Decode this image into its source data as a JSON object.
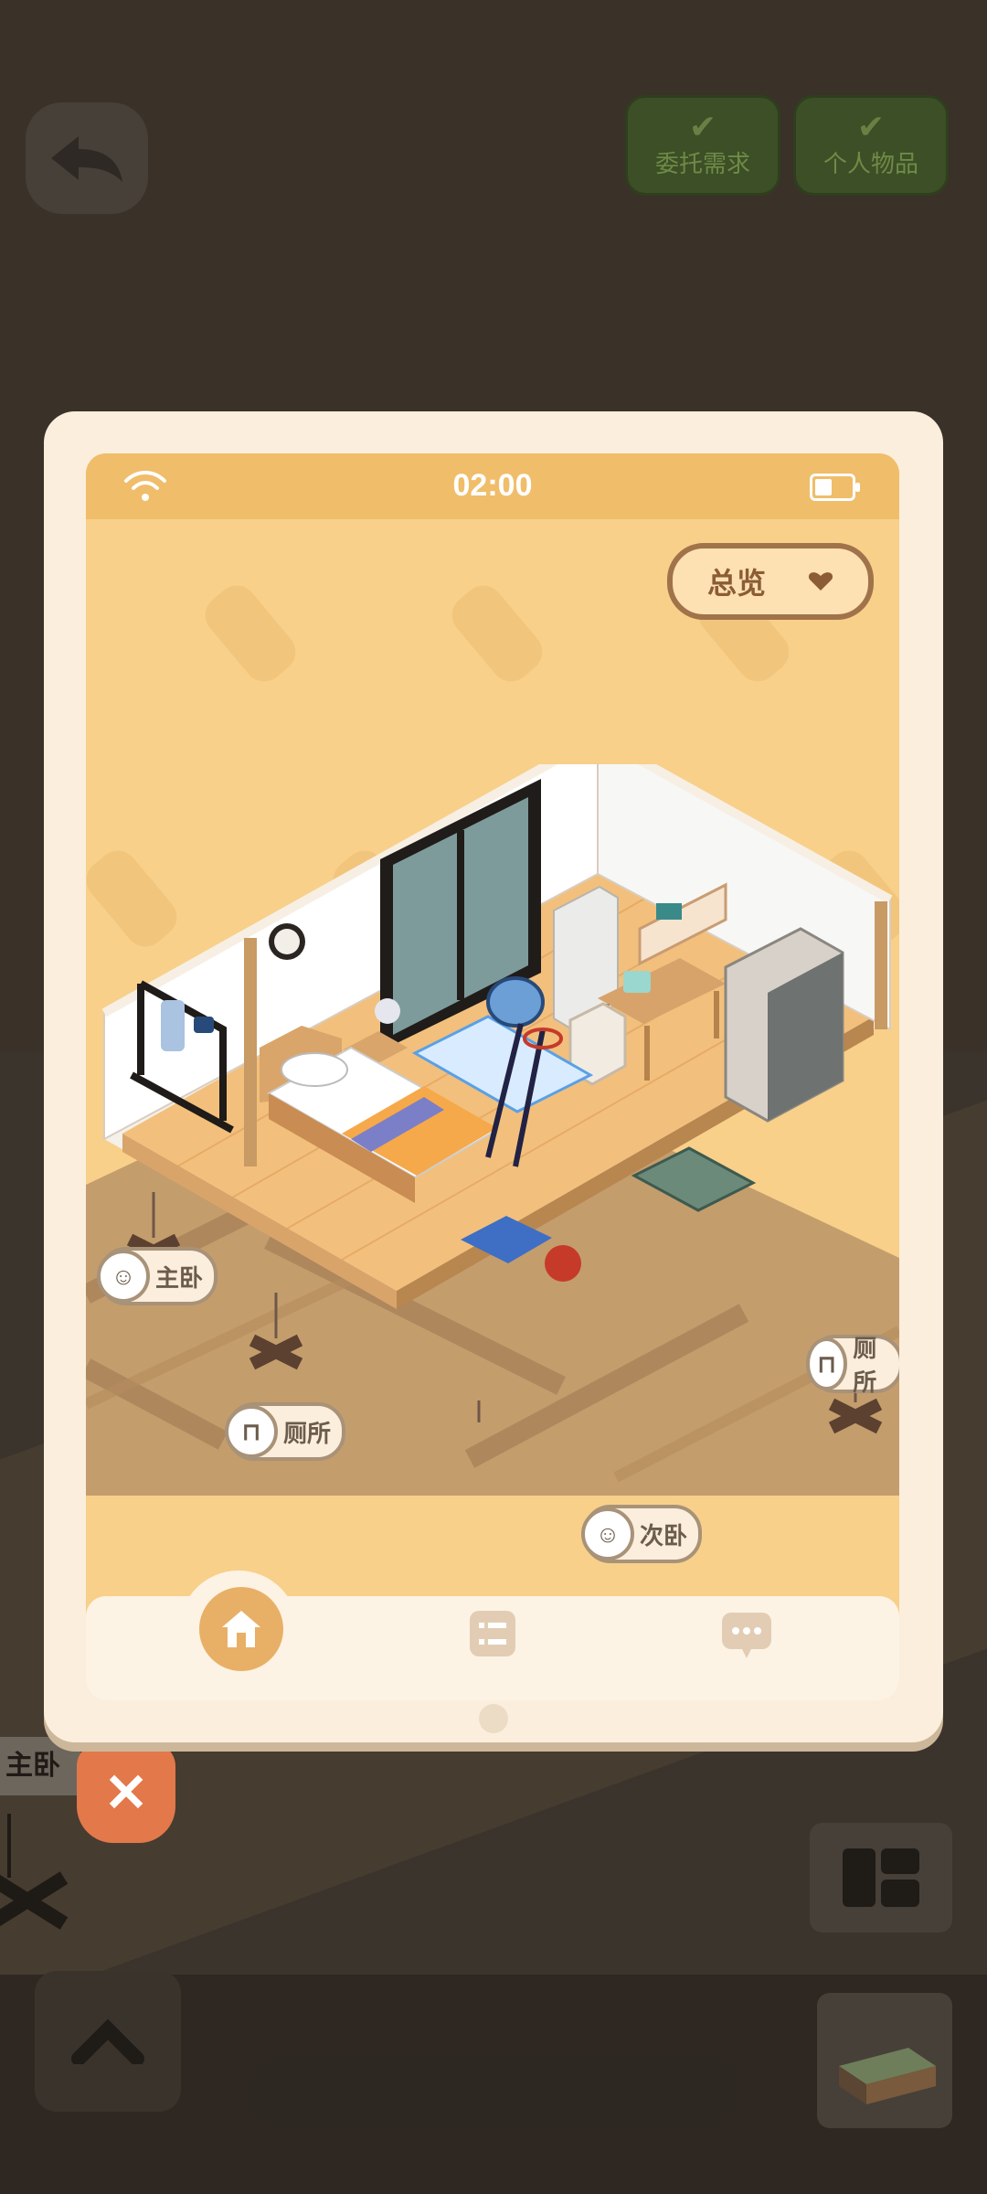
{
  "status_bar": {
    "time": "02:00"
  },
  "top_buttons": {
    "commission": "委托需求",
    "personal_items": "个人物品"
  },
  "overview_select": {
    "selected": "总览"
  },
  "room_labels": {
    "master_bedroom": "主卧",
    "toilet": "厕所",
    "second_bedroom": "次卧",
    "right_toilet": "厕所"
  },
  "background_tag": {
    "master_bedroom": "主卧"
  },
  "close_button": {
    "label": "✕"
  },
  "nav": {
    "home": "home-icon",
    "list": "list-icon",
    "chat": "chat-icon"
  },
  "colors": {
    "screen": "#f8d08a",
    "status_bar": "#f0bd6a",
    "close": "#e3784a",
    "nav_active": "#e8b066"
  }
}
